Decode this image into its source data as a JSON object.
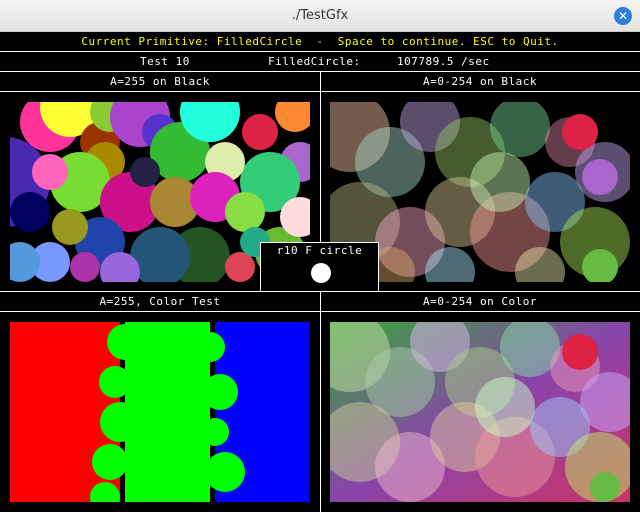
{
  "window": {
    "title": "./TestGfx"
  },
  "header": {
    "primitive_line": "Current Primitive: FilledCircle  -  Space to continue. ESC to Quit.",
    "primitive_color": "#ffff00",
    "test_label": "Test 10",
    "primitive_name": "FilledCircle:",
    "rate": "107789.5 /sec"
  },
  "panels": [
    {
      "label": "A=255 on Black"
    },
    {
      "label": "A=0-254 on Black"
    },
    {
      "label": "A=255, Color Test"
    },
    {
      "label": "A=0-254 on Color"
    }
  ],
  "inset": {
    "label": "r10 F circle"
  },
  "colors": {
    "test_red": "#ff0000",
    "test_green": "#00ff00",
    "test_blue": "#0000ff"
  }
}
